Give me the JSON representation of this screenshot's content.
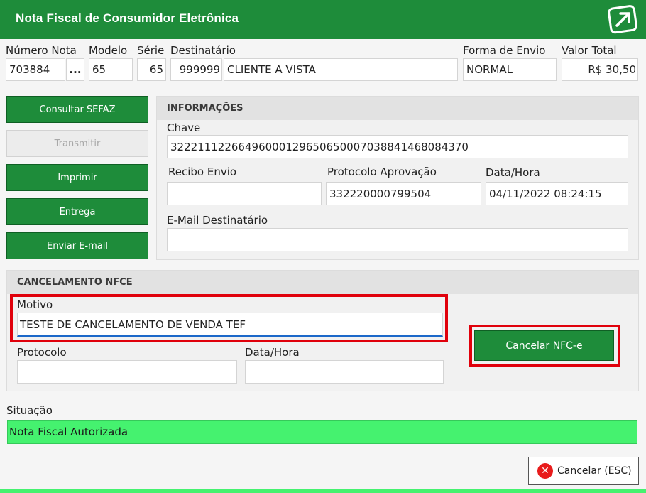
{
  "window": {
    "title": "Nota Fiscal de Consumidor Eletrônica",
    "logo_icon": "arrow-box-icon"
  },
  "header": {
    "numero_nota": {
      "label": "Número Nota",
      "value": "703884",
      "lookup": "..."
    },
    "modelo": {
      "label": "Modelo",
      "value": "65"
    },
    "serie": {
      "label": "Série",
      "value": "65"
    },
    "destinatario": {
      "label": "Destinatário",
      "code": "999999",
      "name": "CLIENTE A VISTA"
    },
    "forma_envio": {
      "label": "Forma de Envio",
      "value": "NORMAL"
    },
    "valor_total": {
      "label": "Valor Total",
      "value": "R$ 30,50"
    }
  },
  "actions": {
    "consultar": "Consultar SEFAZ",
    "transmitir": "Transmitir",
    "imprimir": "Imprimir",
    "entrega": "Entrega",
    "enviar_email": "Enviar E-mail"
  },
  "informacoes": {
    "title": "INFORMAÇÕES",
    "chave_label": "Chave",
    "chave_value": "32221112266496000129650650007038841468084370",
    "recibo_label": "Recibo Envio",
    "recibo_value": "",
    "protocolo_label": "Protocolo Aprovação",
    "protocolo_value": "332220000799504",
    "datahora_label": "Data/Hora",
    "datahora_value": "04/11/2022 08:24:15",
    "email_label": "E-Mail Destinatário",
    "email_value": ""
  },
  "cancelamento": {
    "title": "CANCELAMENTO NFCE",
    "motivo_label": "Motivo",
    "motivo_value": "TESTE DE CANCELAMENTO DE VENDA TEF",
    "protocolo_label": "Protocolo",
    "protocolo_value": "",
    "datahora_label": "Data/Hora",
    "datahora_value": "",
    "cancel_button": "Cancelar NFC-e"
  },
  "situacao": {
    "label": "Situação",
    "value": "Nota Fiscal Autorizada"
  },
  "footer": {
    "cancel_label": "Cancelar (ESC)",
    "cancel_icon": "close-circle-icon"
  },
  "colors": {
    "brand_green": "#1e8c3a",
    "status_green": "#45f26f",
    "highlight_red": "#e0000b"
  }
}
